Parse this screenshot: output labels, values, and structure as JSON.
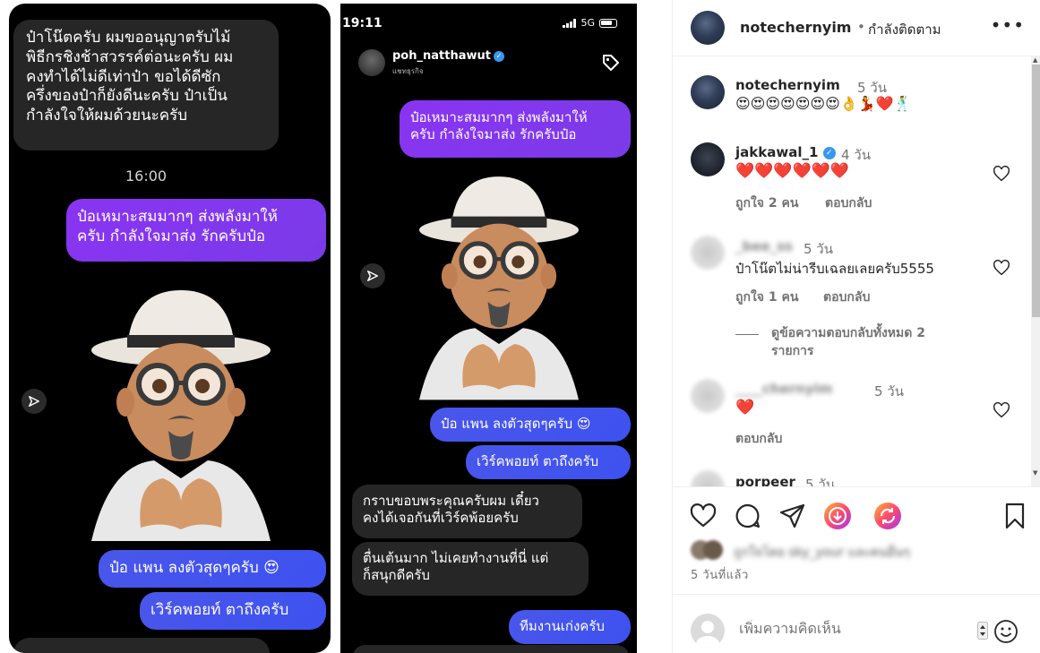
{
  "media": {
    "shot1": {
      "gray_message": "ป๋าโน๊ตครับ ผมขออนุญาตรับไม้\nพิธีกรชิงช้าสวรรค์ต่อนะครับ ผม\nคงทำได้ไม่ดีเท่าป๋า ขอได้ดีซัก\nครึ่งของป๋าก็ยังดีนะครับ ป๋าเป็น\nกำลังใจให้ผมด้วยนะครับ",
      "time": "16:00",
      "purple_message": "ป๋อเหมาะสมมากๆ ส่งพลังมาให้\nครับ กำลังใจมาส่ง รักครับป๋อ",
      "blue_message_1": "ป๋อ แพน ลงตัวสุดๆครับ 😍",
      "blue_message_2": "เวิร์คพอยท์ ตาถึงครับ"
    },
    "shot2": {
      "status_time": "19:11",
      "network": "5G",
      "username": "poh_natthawut",
      "subtitle": "แชทธุรกิจ",
      "purple_message": "ป๋อเหมาะสมมากๆ ส่งพลังมาให้\nครับ กำลังใจมาส่ง รักครับป๋อ",
      "blue_message_1": "ป๋อ แพน ลงตัวสุดๆครับ 😍",
      "blue_message_2": "เวิร์คพอยท์ ตาถึงครับ",
      "gray_message_1": "กราบขอบพระคุณครับผม เดี๋ยว\nคงได้เจอกันที่เวิร์คพ้อยครับ",
      "gray_message_2": "ตื่นเต้นมาก ไม่เคยทำงานที่นี่ แต่\nก็สนุกดีครับ",
      "blue_message_3": "ทีมงานเก่งครับ"
    }
  },
  "header": {
    "username": "notechernyim",
    "separator": "•",
    "follow_status": "กำลังติดตาม",
    "more_icon": "more-horizontal-icon"
  },
  "comments": [
    {
      "username": "notechernyim",
      "time": "5 วัน",
      "text": "😍😍😍😍😍😍😍👌💃❤️🕺"
    },
    {
      "username": "jakkawal_1",
      "time": "4 วัน",
      "text": "❤️❤️❤️❤️❤️❤️",
      "likes": "ถูกใจ 2 คน",
      "reply": "ตอบกลับ"
    },
    {
      "username": "_bee_ss",
      "time": "5 วัน",
      "text": "ป๋าโน๊ตไม่น่ารีบเฉลยเลยครับ5555",
      "likes": "ถูกใจ 1 คน",
      "reply": "ตอบกลับ",
      "view_replies": "ดูข้อความตอบกลับทั้งหมด 2\nรายการ"
    },
    {
      "username": "____chernyim",
      "time": "5 วัน",
      "text": "❤️",
      "reply": "ตอบกลับ"
    },
    {
      "username": "porpeer",
      "time": "5 วัน"
    }
  ],
  "footer": {
    "likes_text": "ถูกใจโดย sky_your และคนอื่นๆ",
    "time_ago": "5 วันที่แล้ว",
    "add_comment_placeholder": "เพิ่มความคิดเห็น"
  },
  "colors": {
    "dm_purple": "#8a34f2",
    "dm_blue": "#4a56ea",
    "dm_gray": "#262626",
    "verified": "#3897f0",
    "instagram_text": "#262626",
    "muted": "#737373"
  }
}
